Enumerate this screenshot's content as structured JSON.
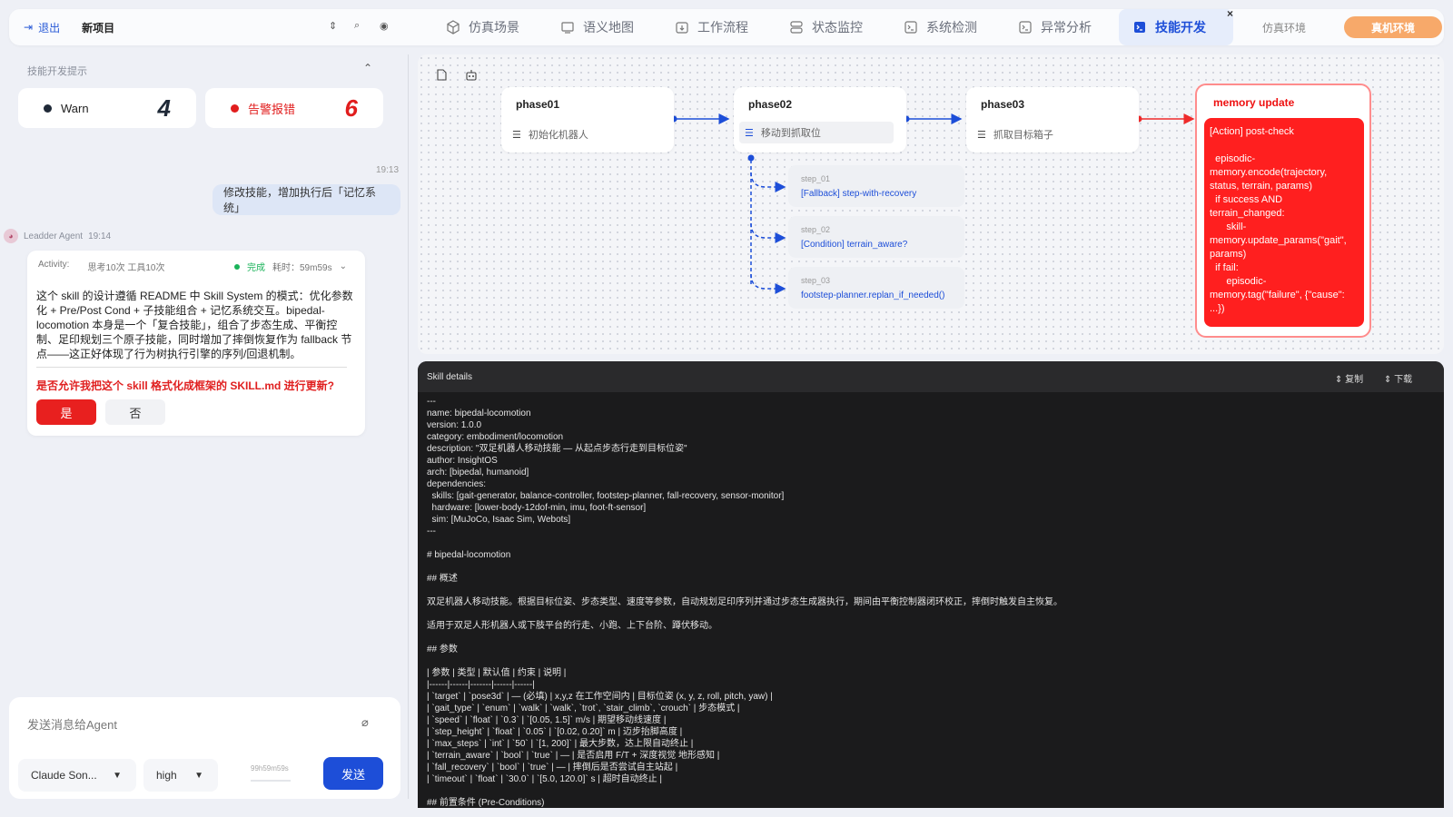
{
  "topbar": {
    "exit_label": "退出",
    "project": "新项目",
    "tabs": [
      {
        "label": "仿真场景",
        "icon": "cube-icon"
      },
      {
        "label": "语义地图",
        "icon": "map-icon"
      },
      {
        "label": "工作流程",
        "icon": "workflow-icon"
      },
      {
        "label": "状态监控",
        "icon": "monitor-icon"
      },
      {
        "label": "系统检测",
        "icon": "terminal-icon"
      },
      {
        "label": "异常分析",
        "icon": "terminal-icon"
      },
      {
        "label": "技能开发",
        "icon": "terminal-icon",
        "active": true
      }
    ],
    "close_glyph": "×",
    "env_sim": "仿真环境",
    "env_real": "真机环境"
  },
  "left": {
    "hint_title": "技能开发提示",
    "warn": {
      "label": "Warn",
      "count": "4",
      "color": "#1f2937"
    },
    "alarm": {
      "label": "告警报错",
      "count": "6",
      "color": "#e11d1d"
    },
    "user_msg_time": "19:13",
    "user_msg": "修改技能，增加执行后「记忆系统」",
    "agent_name": "Leadder Agent",
    "agent_time": "19:14",
    "activity": {
      "label": "Activity:",
      "summary": "思考10次 工具10次",
      "status": "完成",
      "elapsed": "耗时：59m59s"
    },
    "reply_text": "这个 skill 的设计遵循 README 中 Skill System 的模式：优化参数化 + Pre/Post Cond + 子技能组合 + 记忆系统交互。bipedal-locomotion 本身是一个「复合技能」，组合了步态生成、平衡控制、足印规划三个原子技能，同时增加了摔倒恢复作为 fallback 节点——这正好体现了行为树执行引擎的序列/回退机制。",
    "question": "是否允许我把这个 skill 格式化成框架的 SKILL.md 进行更新?",
    "yes": "是",
    "no": "否",
    "input_placeholder": "发送消息给Agent",
    "model": "Claude Son...",
    "effort": "high",
    "timer": "99h59m59s",
    "send": "发送"
  },
  "canvas": {
    "phases": [
      {
        "title": "phase01",
        "task": "初始化机器人"
      },
      {
        "title": "phase02",
        "task": "移动到抓取位"
      },
      {
        "title": "phase03",
        "task": "抓取目标箱子"
      }
    ],
    "memory": {
      "title": "memory update",
      "body": "[Action] post-check\n\n  episodic-memory.encode(trajectory, status, terrain, params)\n  if success AND terrain_changed:\n      skill-memory.update_params(\"gait\", params)\n  if fail:\n      episodic-memory.tag(\"failure\", {\"cause\": ...})"
    },
    "steps": [
      {
        "label": "step_01",
        "value": "[Fallback] step-with-recovery"
      },
      {
        "label": "step_02",
        "value": "[Condition] terrain_aware?"
      },
      {
        "label": "step_03",
        "value": "footstep-planner.replan_if_needed()"
      }
    ],
    "colors": {
      "blue": "#1d4ed8",
      "red": "#ef2b2b"
    }
  },
  "code": {
    "title": "Skill details",
    "copy": "复制",
    "download": "下载",
    "lines": [
      "---",
      "name: bipedal-locomotion",
      "version: 1.0.0",
      "category: embodiment/locomotion",
      "description: \"双足机器人移动技能 — 从起点步态行走到目标位姿\"",
      "author: InsightOS",
      "arch: [bipedal, humanoid]",
      "dependencies:",
      "  skills: [gait-generator, balance-controller, footstep-planner, fall-recovery, sensor-monitor]",
      "  hardware: [lower-body-12dof-min, imu, foot-ft-sensor]",
      "  sim: [MuJoCo, Isaac Sim, Webots]",
      "---",
      "",
      "# bipedal-locomotion",
      "",
      "## 概述",
      "",
      "双足机器人移动技能。根据目标位姿、步态类型、速度等参数，自动规划足印序列并通过步态生成器执行，期间由平衡控制器闭环校正，摔倒时触发自主恢复。",
      "",
      "适用于双足人形机器人或下肢平台的行走、小跑、上下台阶、蹲伏移动。",
      "",
      "## 参数",
      "",
      "| 参数 | 类型 | 默认值 | 约束 | 说明 |",
      "|------|------|-------|------|------|",
      "| `target` | `pose3d` | — (必填) | x,y,z 在工作空间内 | 目标位姿 (x, y, z, roll, pitch, yaw) |",
      "| `gait_type` | `enum` | `walk` | `walk`, `trot`, `stair_climb`, `crouch` | 步态模式 |",
      "| `speed` | `float` | `0.3` | `[0.05, 1.5]` m/s | 期望移动线速度 |",
      "| `step_height` | `float` | `0.05` | `[0.02, 0.20]` m | 迈步抬脚高度 |",
      "| `max_steps` | `int` | `50` | `[1, 200]` | 最大步数，达上限自动终止 |",
      "| `terrain_aware` | `bool` | `true` | — | 是否启用 F/T + 深度视觉 地形感知 |",
      "| `fall_recovery` | `bool` | `true` | — | 摔倒后是否尝试自主站起 |",
      "| `timeout` | `float` | `30.0` | `[5.0, 120.0]` s | 超时自动终止 |",
      "",
      "## 前置条件 (Pre-Conditions)"
    ]
  }
}
